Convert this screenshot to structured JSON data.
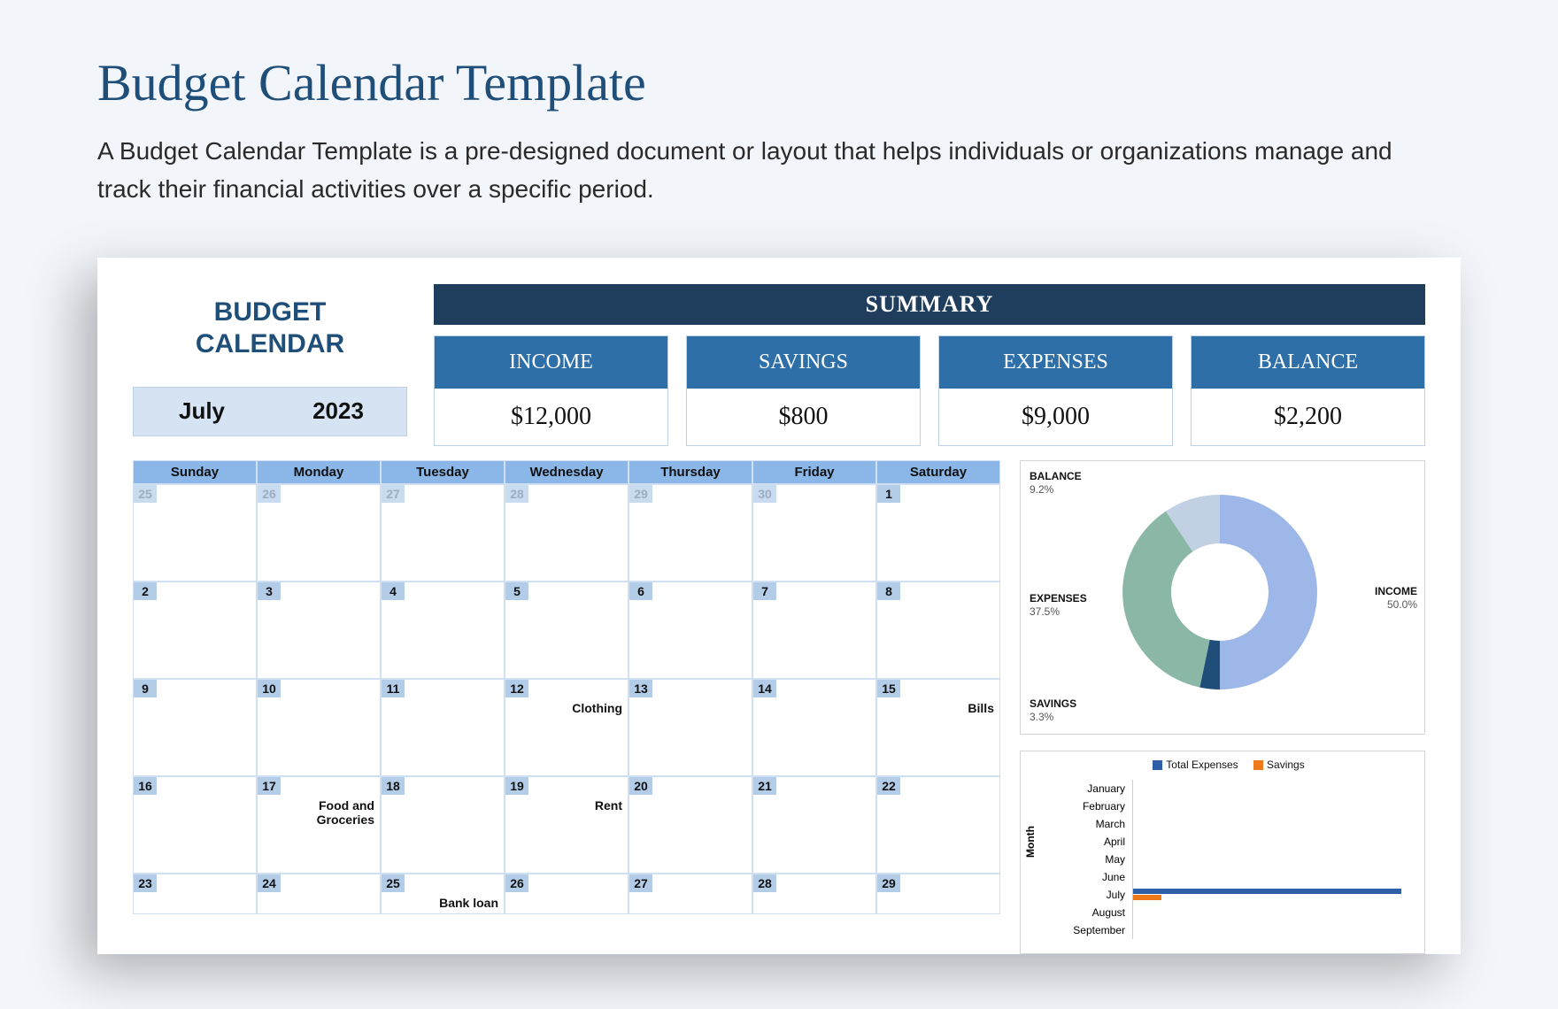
{
  "page": {
    "title": "Budget Calendar Template",
    "description": "A Budget Calendar Template is a pre-designed document or layout that helps individuals or organizations manage and track their financial activities over a specific period."
  },
  "header": {
    "title_line1": "BUDGET",
    "title_line2": "CALENDAR",
    "month": "July",
    "year": "2023"
  },
  "summary": {
    "title": "SUMMARY",
    "cards": [
      {
        "label": "INCOME",
        "value": "$12,000"
      },
      {
        "label": "SAVINGS",
        "value": "$800"
      },
      {
        "label": "EXPENSES",
        "value": "$9,000"
      },
      {
        "label": "BALANCE",
        "value": "$2,200"
      }
    ]
  },
  "calendar": {
    "dow": [
      "Sunday",
      "Monday",
      "Tuesday",
      "Wednesday",
      "Thursday",
      "Friday",
      "Saturday"
    ],
    "weeks": [
      [
        {
          "n": "25",
          "muted": true
        },
        {
          "n": "26",
          "muted": true
        },
        {
          "n": "27",
          "muted": true
        },
        {
          "n": "28",
          "muted": true
        },
        {
          "n": "29",
          "muted": true
        },
        {
          "n": "30",
          "muted": true
        },
        {
          "n": "1"
        }
      ],
      [
        {
          "n": "2"
        },
        {
          "n": "3"
        },
        {
          "n": "4"
        },
        {
          "n": "5"
        },
        {
          "n": "6"
        },
        {
          "n": "7"
        },
        {
          "n": "8"
        }
      ],
      [
        {
          "n": "9"
        },
        {
          "n": "10"
        },
        {
          "n": "11"
        },
        {
          "n": "12",
          "event": "Clothing"
        },
        {
          "n": "13"
        },
        {
          "n": "14"
        },
        {
          "n": "15",
          "event": "Bills"
        }
      ],
      [
        {
          "n": "16"
        },
        {
          "n": "17",
          "event": "Food and Groceries"
        },
        {
          "n": "18"
        },
        {
          "n": "19",
          "event": "Rent"
        },
        {
          "n": "20"
        },
        {
          "n": "21"
        },
        {
          "n": "22"
        }
      ],
      [
        {
          "n": "23"
        },
        {
          "n": "24"
        },
        {
          "n": "25",
          "event": "Bank loan"
        },
        {
          "n": "26"
        },
        {
          "n": "27"
        },
        {
          "n": "28"
        },
        {
          "n": "29"
        }
      ]
    ]
  },
  "donut": {
    "labels": {
      "balance": {
        "name": "BALANCE",
        "pct": "9.2%"
      },
      "income": {
        "name": "INCOME",
        "pct": "50.0%"
      },
      "expenses": {
        "name": "EXPENSES",
        "pct": "37.5%"
      },
      "savings": {
        "name": "SAVINGS",
        "pct": "3.3%"
      }
    }
  },
  "barchart": {
    "legend": {
      "series1": "Total Expenses",
      "series2": "Savings"
    },
    "ylabel": "Month",
    "months": [
      "January",
      "February",
      "March",
      "April",
      "May",
      "June",
      "July",
      "August",
      "September"
    ],
    "data": {
      "July": {
        "expenses": 95,
        "savings": 10
      }
    }
  },
  "chart_data": [
    {
      "type": "pie",
      "title": "",
      "series": [
        {
          "name": "INCOME",
          "value": 50.0
        },
        {
          "name": "EXPENSES",
          "value": 37.5
        },
        {
          "name": "BALANCE",
          "value": 9.2
        },
        {
          "name": "SAVINGS",
          "value": 3.3
        }
      ]
    },
    {
      "type": "bar",
      "orientation": "horizontal",
      "title": "",
      "xlabel": "",
      "ylabel": "Month",
      "categories": [
        "January",
        "February",
        "March",
        "April",
        "May",
        "June",
        "July",
        "August",
        "September"
      ],
      "series": [
        {
          "name": "Total Expenses",
          "values": [
            0,
            0,
            0,
            0,
            0,
            0,
            9000,
            0,
            0
          ]
        },
        {
          "name": "Savings",
          "values": [
            0,
            0,
            0,
            0,
            0,
            0,
            800,
            0,
            0
          ]
        }
      ]
    }
  ]
}
